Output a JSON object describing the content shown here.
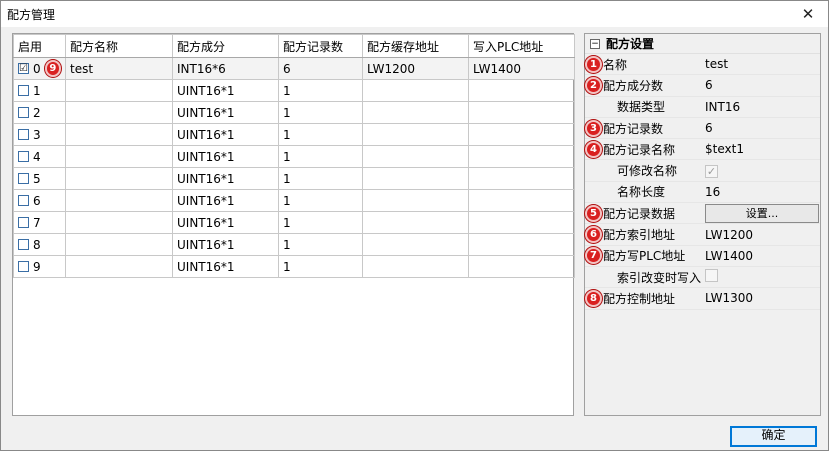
{
  "window": {
    "title": "配方管理",
    "close_glyph": "✕"
  },
  "table": {
    "headers": [
      "启用",
      "配方名称",
      "配方成分",
      "配方记录数",
      "配方缓存地址",
      "写入PLC地址"
    ],
    "rows": [
      {
        "index": "0",
        "checked": "☑",
        "badge": "9",
        "name": "test",
        "component": "INT16*6",
        "records": "6",
        "cache": "LW1200",
        "plc": "LW1400"
      },
      {
        "index": "1",
        "checked": "",
        "badge": "",
        "name": "",
        "component": "UINT16*1",
        "records": "1",
        "cache": "",
        "plc": ""
      },
      {
        "index": "2",
        "checked": "",
        "badge": "",
        "name": "",
        "component": "UINT16*1",
        "records": "1",
        "cache": "",
        "plc": ""
      },
      {
        "index": "3",
        "checked": "",
        "badge": "",
        "name": "",
        "component": "UINT16*1",
        "records": "1",
        "cache": "",
        "plc": ""
      },
      {
        "index": "4",
        "checked": "",
        "badge": "",
        "name": "",
        "component": "UINT16*1",
        "records": "1",
        "cache": "",
        "plc": ""
      },
      {
        "index": "5",
        "checked": "",
        "badge": "",
        "name": "",
        "component": "UINT16*1",
        "records": "1",
        "cache": "",
        "plc": ""
      },
      {
        "index": "6",
        "checked": "",
        "badge": "",
        "name": "",
        "component": "UINT16*1",
        "records": "1",
        "cache": "",
        "plc": ""
      },
      {
        "index": "7",
        "checked": "",
        "badge": "",
        "name": "",
        "component": "UINT16*1",
        "records": "1",
        "cache": "",
        "plc": ""
      },
      {
        "index": "8",
        "checked": "",
        "badge": "",
        "name": "",
        "component": "UINT16*1",
        "records": "1",
        "cache": "",
        "plc": ""
      },
      {
        "index": "9",
        "checked": "",
        "badge": "",
        "name": "",
        "component": "UINT16*1",
        "records": "1",
        "cache": "",
        "plc": ""
      }
    ]
  },
  "props": {
    "header": "配方设置",
    "toggle": "−",
    "rows": [
      {
        "badge": "1",
        "label": "名称",
        "value": "test"
      },
      {
        "badge": "2",
        "label": "配方成分数",
        "value": "6"
      },
      {
        "badge": "",
        "label": "数据类型",
        "value": "INT16"
      },
      {
        "badge": "3",
        "label": "配方记录数",
        "value": "6"
      },
      {
        "badge": "4",
        "label": "配方记录名称",
        "value": "$text1"
      },
      {
        "badge": "",
        "label": "可修改名称",
        "value": "✓"
      },
      {
        "badge": "",
        "label": "名称长度",
        "value": "16"
      },
      {
        "badge": "5",
        "label": "配方记录数据",
        "value": "设置..."
      },
      {
        "badge": "6",
        "label": "配方索引地址",
        "value": "LW1200"
      },
      {
        "badge": "7",
        "label": "配方写PLC地址",
        "value": "LW1400"
      },
      {
        "badge": "",
        "label": "索引改变时写入",
        "value": ""
      },
      {
        "badge": "8",
        "label": "配方控制地址",
        "value": "LW1300"
      }
    ]
  },
  "footer": {
    "ok_label": "确定"
  }
}
